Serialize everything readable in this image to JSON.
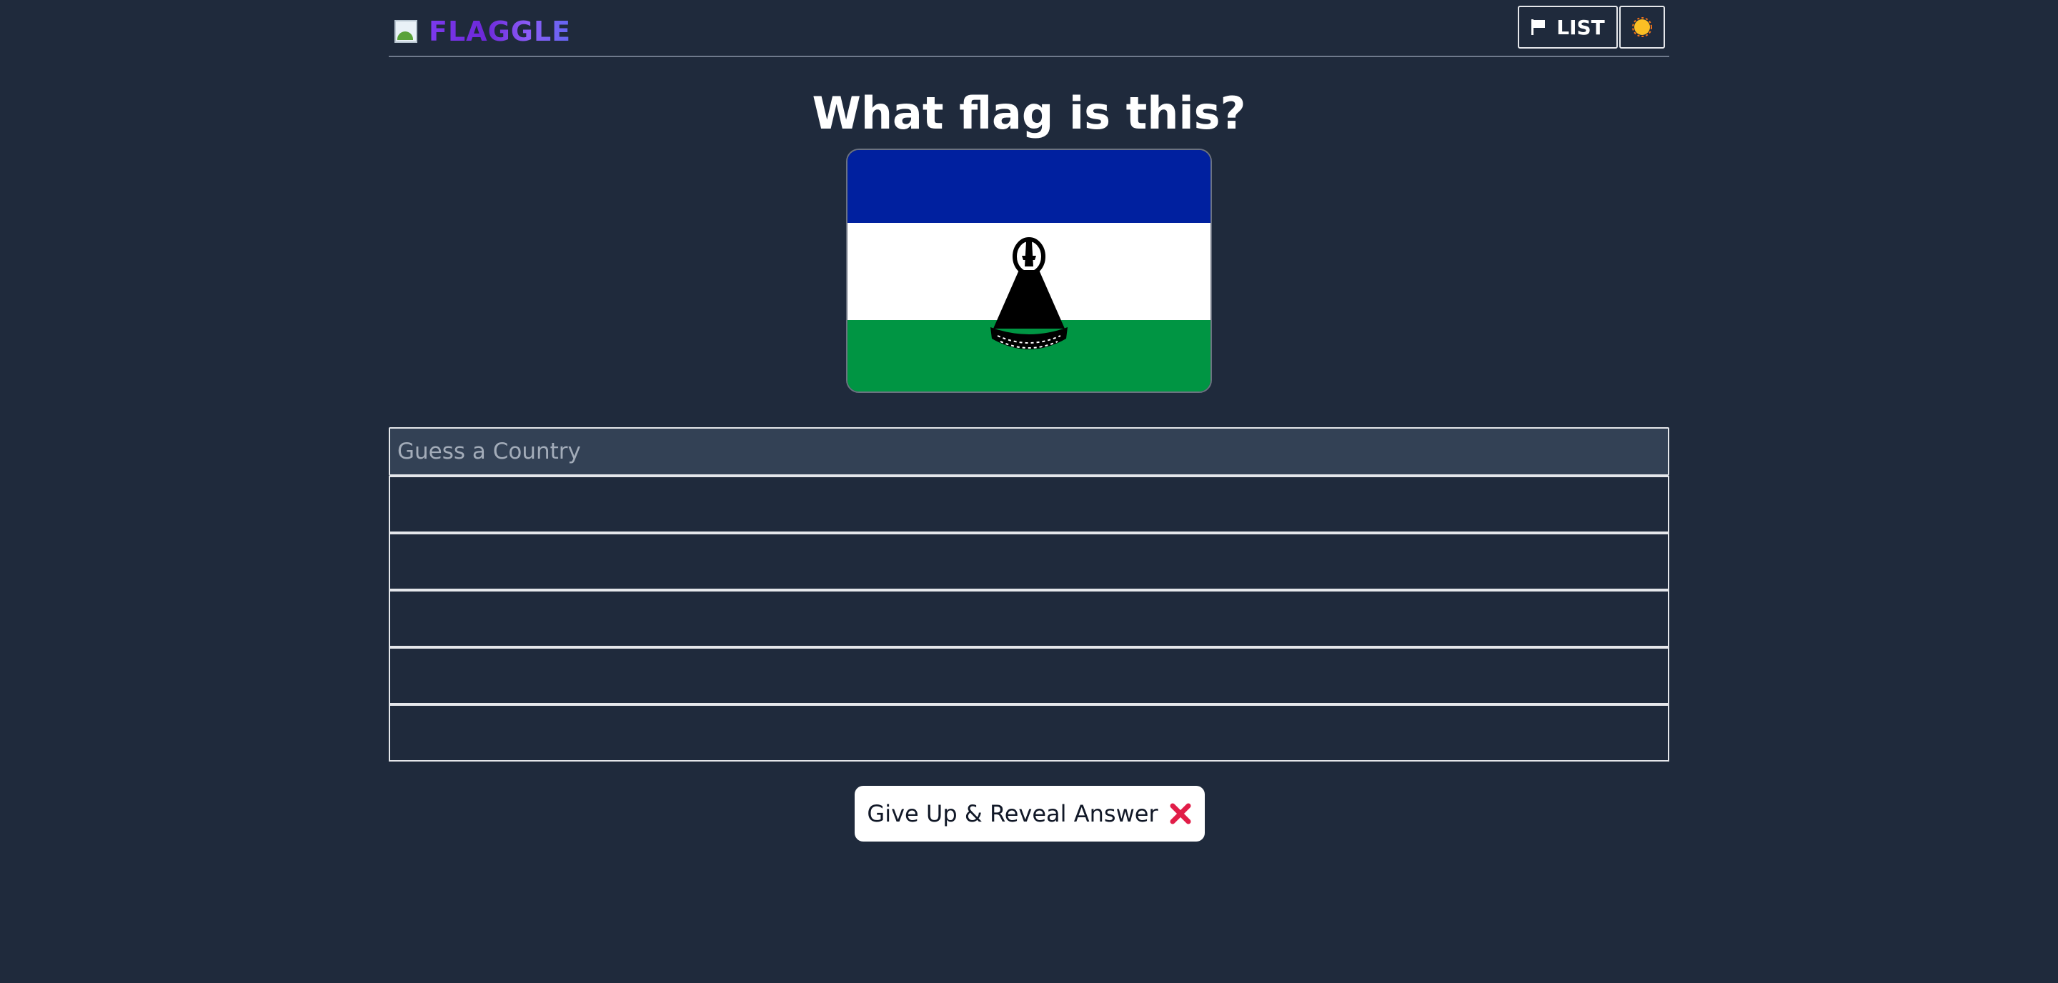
{
  "app": {
    "name": "FLAGGLE",
    "logo_icon": "broken-image-icon"
  },
  "header": {
    "list_button": {
      "label": "LIST",
      "icon": "flag-icon"
    },
    "theme_toggle": {
      "icon": "sun-icon"
    }
  },
  "main": {
    "question": "What flag is this?",
    "flag": {
      "stripes": [
        "#00209F",
        "#FFFFFF",
        "#009543"
      ],
      "emblem_icon": "mokorotlo-hat-icon"
    },
    "guess_input": {
      "placeholder": "Guess a Country",
      "value": ""
    },
    "guesses": [
      "",
      "",
      "",
      "",
      ""
    ],
    "give_up_button": {
      "label": "Give Up & Reveal Answer",
      "icon": "red-x-icon"
    }
  },
  "colors": {
    "background": "#1f2a3c",
    "input_bg": "#334155",
    "accent": "#7c3aed",
    "cross": "#e11d48"
  }
}
